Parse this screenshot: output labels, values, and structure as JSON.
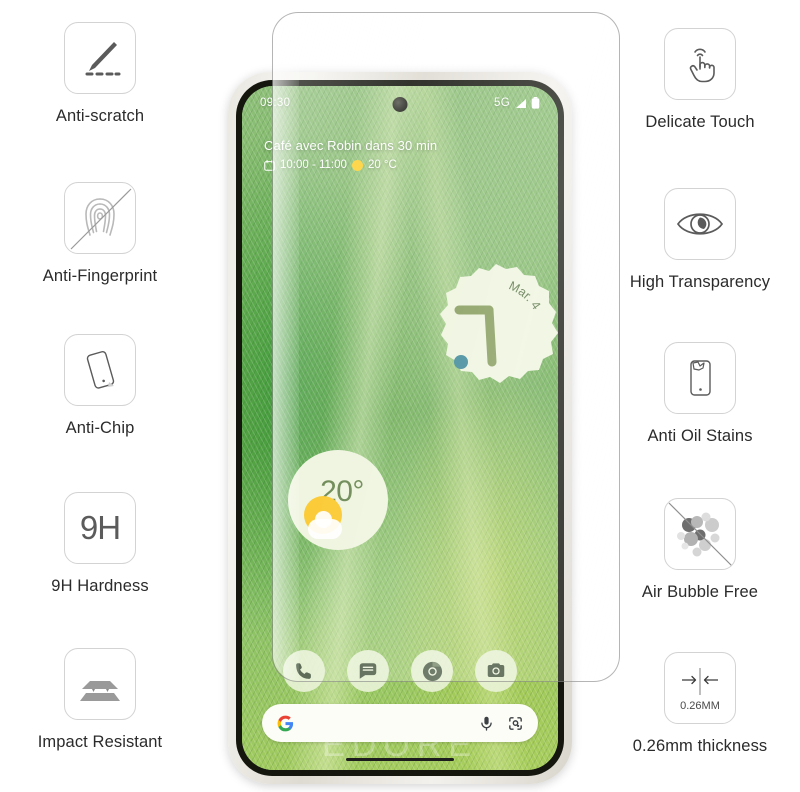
{
  "features_left": [
    {
      "label": "Anti-scratch",
      "icon": "knife-scratch-icon"
    },
    {
      "label": "Anti-Fingerprint",
      "icon": "fingerprint-icon"
    },
    {
      "label": "Anti-Chip",
      "icon": "tilted-phone-icon"
    },
    {
      "label": "9H Hardness",
      "icon": "9h-text-icon",
      "icon_text": "9H"
    },
    {
      "label": "Impact Resistant",
      "icon": "layered-plates-icon"
    }
  ],
  "features_right": [
    {
      "label": "Delicate Touch",
      "icon": "tap-hand-icon"
    },
    {
      "label": "High Transparency",
      "icon": "eye-icon"
    },
    {
      "label": "Anti Oil Stains",
      "icon": "phone-stain-icon"
    },
    {
      "label": "Air Bubble Free",
      "icon": "bubbles-icon"
    },
    {
      "label": "0.26mm thickness",
      "icon": "thickness-arrows-icon",
      "icon_text": "0.26MM"
    }
  ],
  "phone": {
    "status_bar": {
      "time": "09:30",
      "network": "5G",
      "signal_icon": "signal-bars-icon",
      "battery_icon": "battery-icon",
      "camera_icon": "front-camera-punch-hole"
    },
    "smartspace": {
      "title": "Café avec Robin dans 30 min",
      "calendar_icon": "calendar-icon",
      "time_range": "10:00 - 11:00",
      "weather_icon": "sun-icon",
      "temperature": "20 °C"
    },
    "clock_widget": {
      "date": "Mar. 4",
      "hand_color": "#7d9550",
      "dot_color": "#2f7f90",
      "face_color": "#eef4dd"
    },
    "weather_widget": {
      "temperature": "20°",
      "icon": "sun-behind-cloud-icon",
      "sun_color": "#fbc41c",
      "face_color": "#eef4dd"
    },
    "dock": [
      {
        "icon": "phone-icon"
      },
      {
        "icon": "messages-icon"
      },
      {
        "icon": "chrome-icon"
      },
      {
        "icon": "camera-icon"
      }
    ],
    "search_bar": {
      "google_icon": "google-g-icon",
      "mic_icon": "microphone-icon",
      "lens_icon": "google-lens-icon"
    },
    "gesture_bar_icon": "home-gesture-bar",
    "watermark": "EDORE"
  },
  "protector": {
    "name": "screen-protector-film"
  },
  "colors": {
    "icon_border": "#d3d3d3",
    "icon_gray": "#5b5b5b",
    "label_text": "#2b2b2b",
    "wallpaper_green": "#79b65f"
  }
}
